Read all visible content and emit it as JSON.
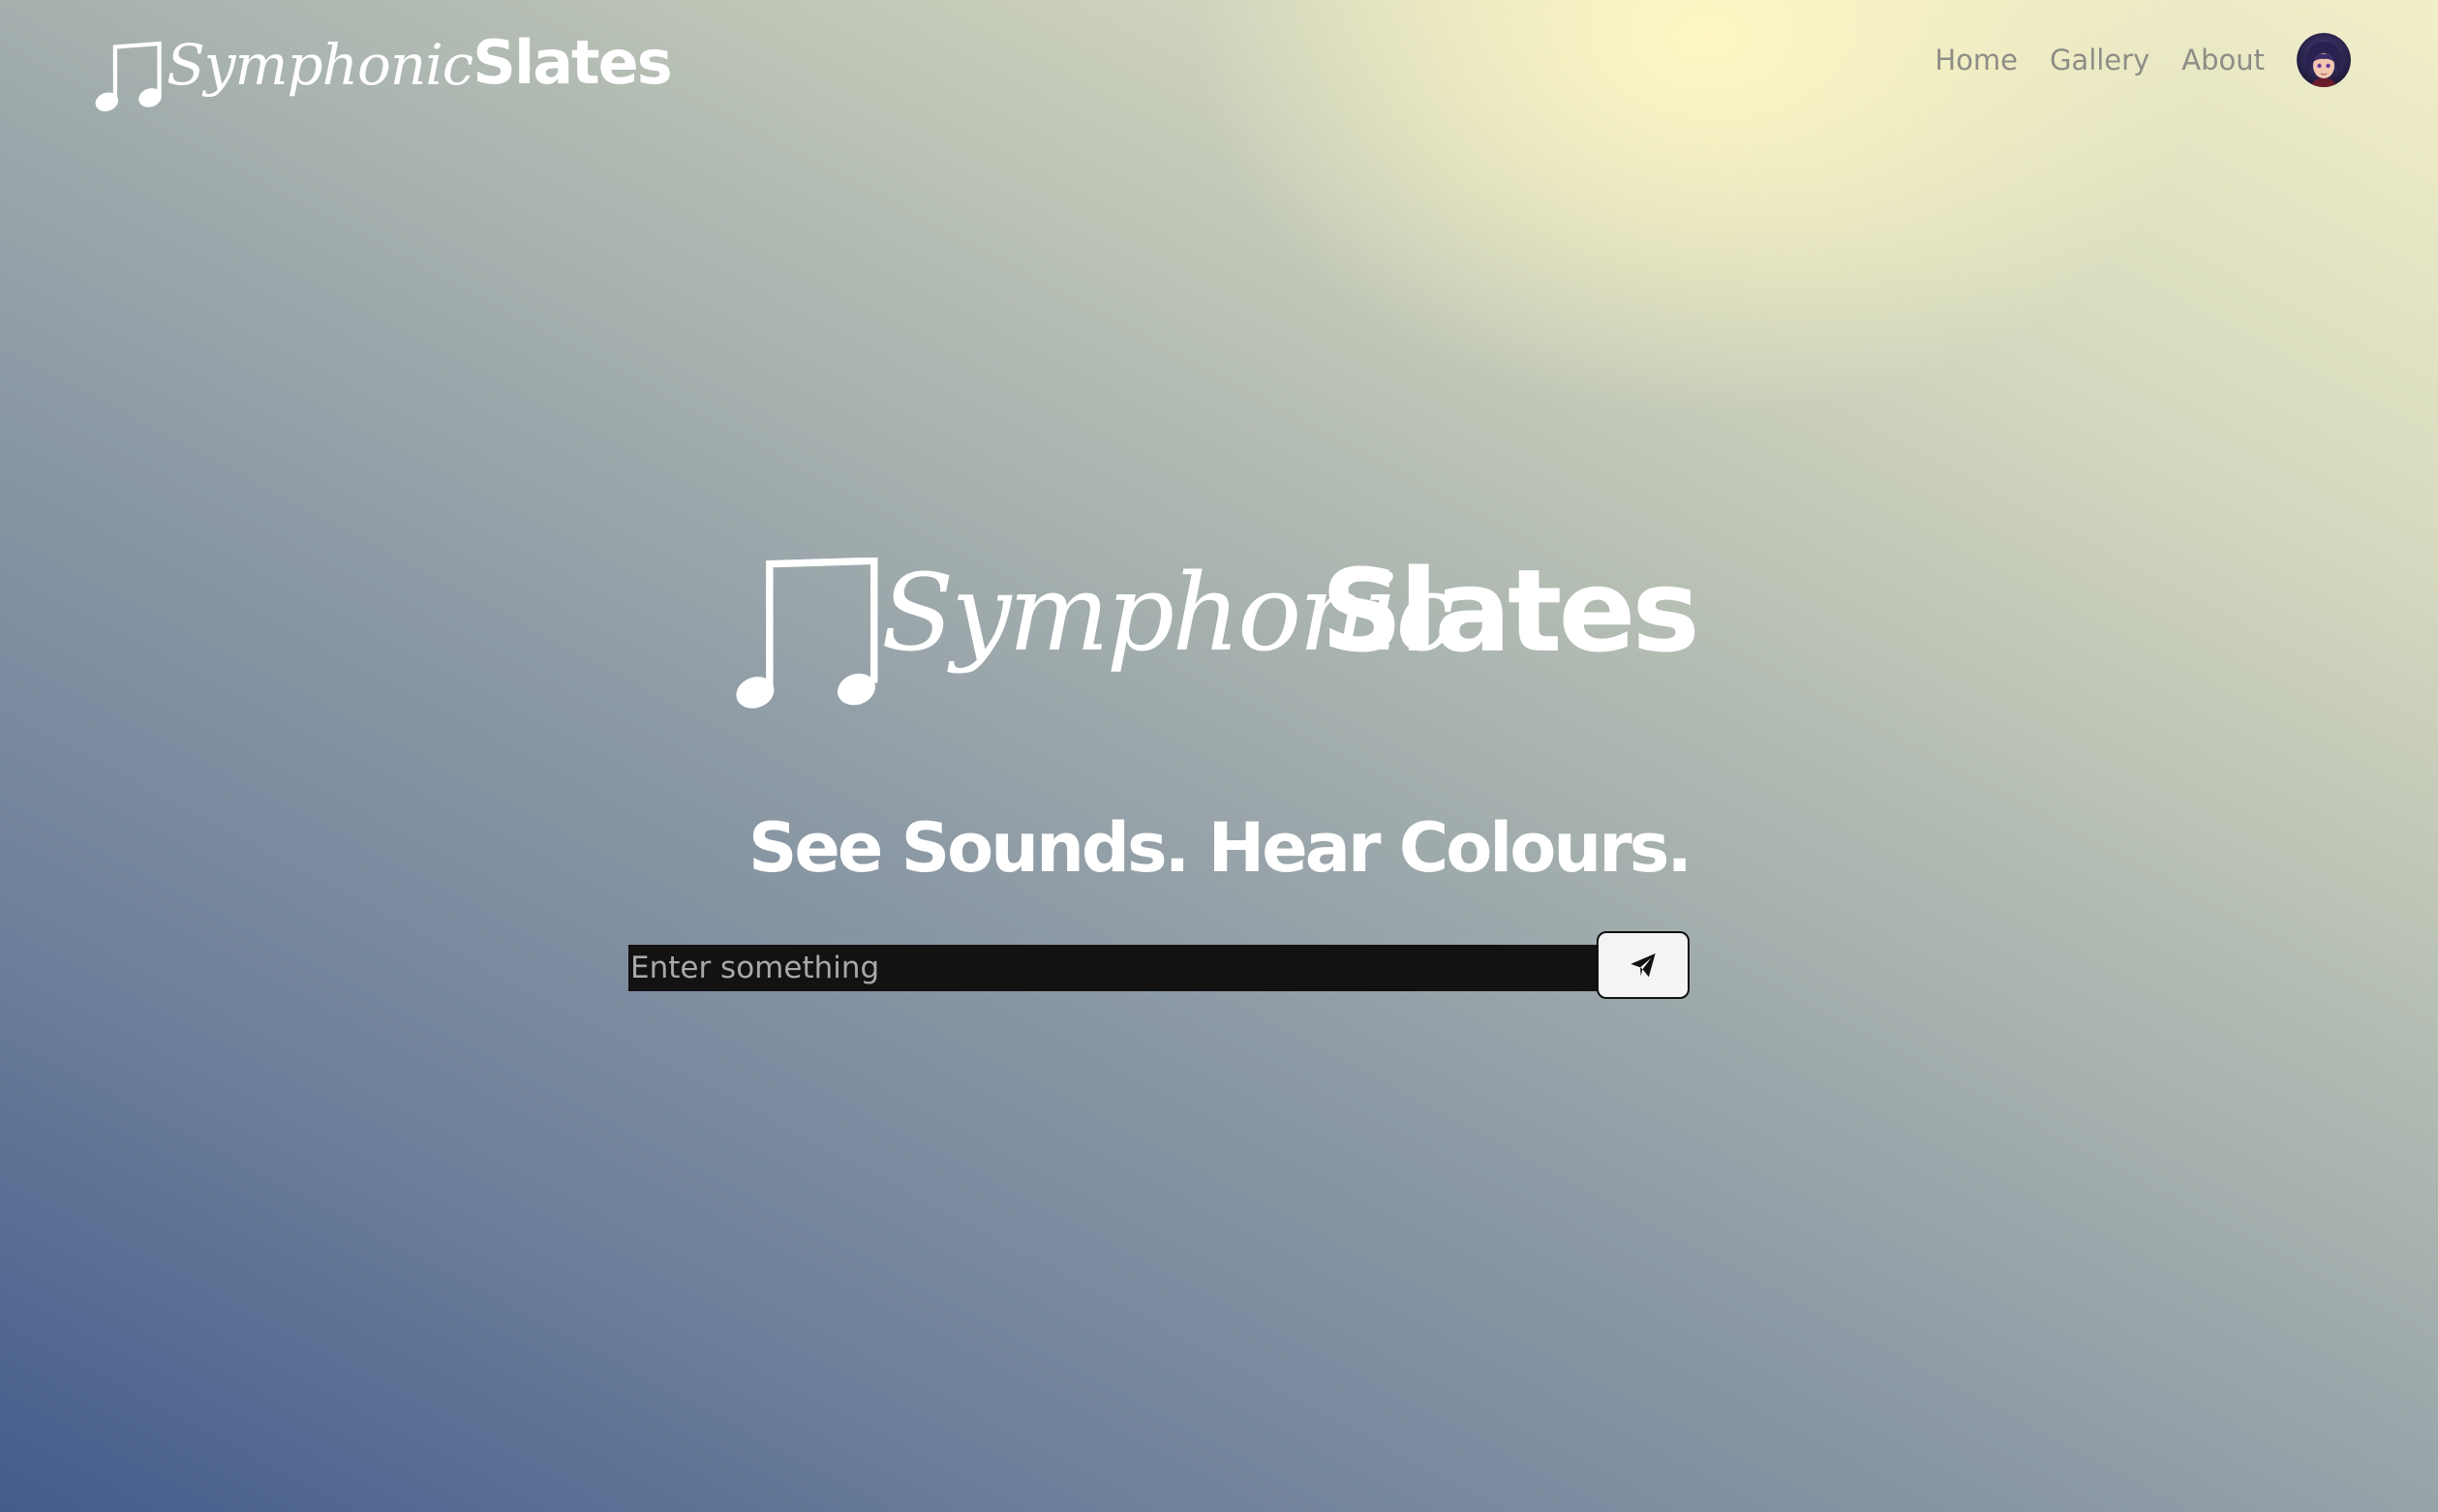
{
  "header": {
    "brand_script": "Symphonic",
    "brand_bold": "Slates",
    "nav": [
      {
        "label": "Home"
      },
      {
        "label": "Gallery"
      },
      {
        "label": "About"
      }
    ],
    "avatar_icon": "user-avatar-icon"
  },
  "hero": {
    "brand_script": "Symphonic",
    "brand_bold": "Slates",
    "tagline": "See Sounds. Hear Colours."
  },
  "search": {
    "placeholder": "Enter something",
    "value": "",
    "submit_icon": "send-icon"
  },
  "colors": {
    "brand_text": "#ffffff",
    "nav_text": "#8d8d86",
    "input_background": "#121212",
    "button_background": "#f4f4f4",
    "gradient_top_right": "#fff8c4",
    "gradient_bottom_left": "#445c8c"
  }
}
